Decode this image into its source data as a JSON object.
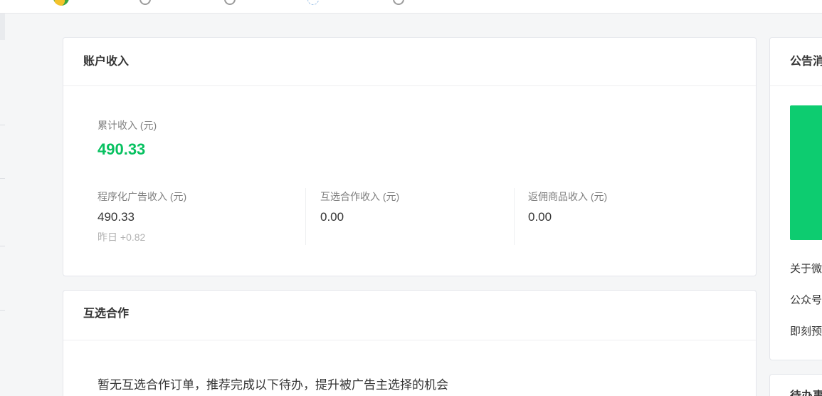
{
  "colors": {
    "accent": "#07c160",
    "banner": "#0dcc70",
    "background": "#f5f6f7",
    "text": "#353535"
  },
  "topbar": {
    "icons": [
      "avatar-icon",
      "circle-icon",
      "circle-icon",
      "dashed-circle-icon",
      "circle-icon"
    ]
  },
  "account_income": {
    "title": "账户收入",
    "total_label": "累计收入 (元)",
    "total_value": "490.33",
    "breakdown": [
      {
        "label": "程序化广告收入 (元)",
        "value": "490.33",
        "sub": "昨日 +0.82"
      },
      {
        "label": "互选合作收入 (元)",
        "value": "0.00"
      },
      {
        "label": "返佣商品收入 (元)",
        "value": "0.00"
      }
    ]
  },
  "cooperation": {
    "title": "互选合作",
    "empty_text": "暂无互选合作订单，推荐完成以下待办，提升被广告主选择的机会"
  },
  "announcements": {
    "title": "公告消",
    "items": [
      "关于微",
      "公众号",
      "即刻预"
    ]
  },
  "todo": {
    "title": "待办事"
  }
}
